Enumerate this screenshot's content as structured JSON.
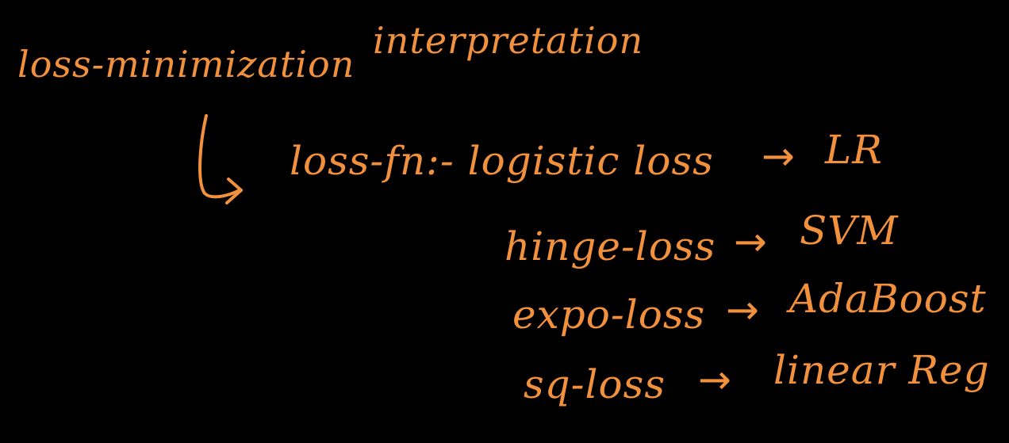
{
  "colors": {
    "background": "#000000",
    "ink": "#f2913d"
  },
  "heading": {
    "left": "loss-minimization",
    "right": "interpretation"
  },
  "rows": [
    {
      "name": "loss-fn:- logistic loss",
      "arrow": "→",
      "model": "LR"
    },
    {
      "name": "hinge-loss",
      "arrow": "→",
      "model": "SVM"
    },
    {
      "name": "expo-loss",
      "arrow": "→",
      "model": "AdaBoost"
    },
    {
      "name": "sq-loss",
      "arrow": "→",
      "model": "linear Reg"
    }
  ],
  "icons": {
    "hook_arrow": "hook-arrow-icon"
  }
}
